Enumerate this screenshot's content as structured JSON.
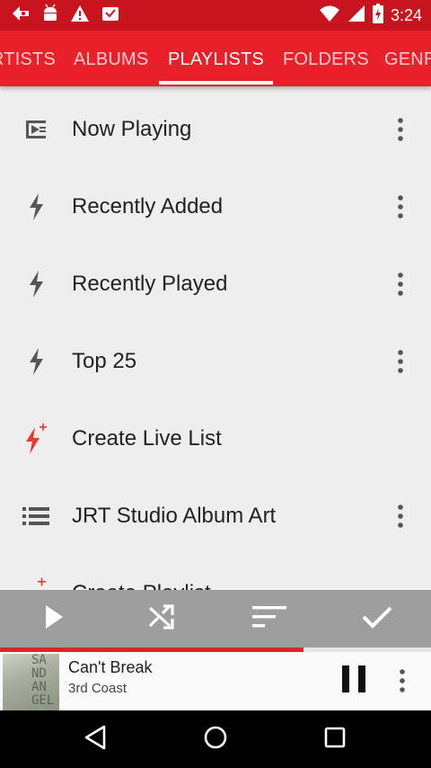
{
  "status_bar": {
    "time": "3:24",
    "left_icons": [
      "play-store-icon",
      "android-icon",
      "warning-icon",
      "inbox-icon"
    ],
    "right_icons": [
      "wifi-icon",
      "signal-icon",
      "battery-icon"
    ]
  },
  "tabs": [
    {
      "label": "RTISTS",
      "active": false
    },
    {
      "label": "ALBUMS",
      "active": false
    },
    {
      "label": "PLAYLISTS",
      "active": true
    },
    {
      "label": "FOLDERS",
      "active": false
    },
    {
      "label": "GENR",
      "active": false
    }
  ],
  "playlists": [
    {
      "label": "Now Playing",
      "icon": "now-playing-icon",
      "has_menu": true
    },
    {
      "label": "Recently Added",
      "icon": "bolt-icon",
      "has_menu": true
    },
    {
      "label": "Recently Played",
      "icon": "bolt-icon",
      "has_menu": true
    },
    {
      "label": "Top 25",
      "icon": "bolt-icon",
      "has_menu": true
    },
    {
      "label": "Create Live List",
      "icon": "bolt-add-icon",
      "has_menu": false
    },
    {
      "label": "JRT Studio Album Art",
      "icon": "list-icon",
      "has_menu": true
    },
    {
      "label": "Create Playlist",
      "icon": "list-add-icon",
      "has_menu": false
    }
  ],
  "action_bar": {
    "buttons": [
      "play-icon",
      "shuffle-icon",
      "sort-icon",
      "check-icon"
    ]
  },
  "player": {
    "progress": 0.705,
    "album_art_lines": [
      "SA",
      "ND",
      "AN",
      "GEL"
    ],
    "title": "Can't Break",
    "artist": "3rd Coast"
  },
  "nav_bar": {
    "buttons": [
      "back-icon",
      "home-icon",
      "recents-icon"
    ]
  },
  "colors": {
    "accent": "#e9202a",
    "status_bar": "#c8141f",
    "live_icon": "#e53935",
    "icon_gray": "#555555",
    "toolbar": "#9e9e9e"
  }
}
